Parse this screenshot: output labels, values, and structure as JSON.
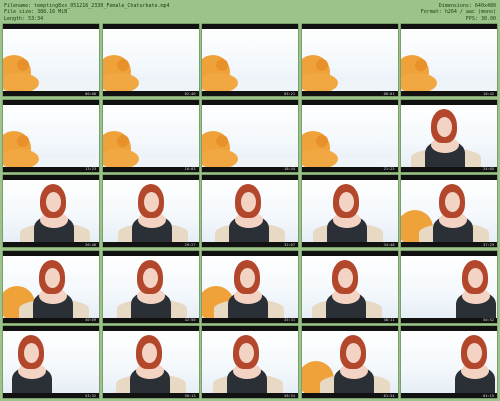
{
  "header": {
    "filename_line": "Filename: tempting8xx_051216_2330_Female_Chaturbate.mp4",
    "filesize_line": "File size: 388.16 MiB",
    "length_line": "Length: 53:34",
    "dimensions_line": "Dimensions: 640x480",
    "format_line": "Format: h264 / aac (mono)",
    "fps_line": "FPS: 30.00"
  },
  "thumbnails": [
    {
      "ts": "00:00",
      "scene": "bear"
    },
    {
      "ts": "02:40",
      "scene": "bear"
    },
    {
      "ts": "05:21",
      "scene": "bear"
    },
    {
      "ts": "08:01",
      "scene": "bear"
    },
    {
      "ts": "10:42",
      "scene": "bear"
    },
    {
      "ts": "13:23",
      "scene": "bear"
    },
    {
      "ts": "16:03",
      "scene": "bear"
    },
    {
      "ts": "18:44",
      "scene": "bear"
    },
    {
      "ts": "21:25",
      "scene": "bear"
    },
    {
      "ts": "24:05",
      "scene": "woman-blanket"
    },
    {
      "ts": "26:46",
      "scene": "woman-center"
    },
    {
      "ts": "29:27",
      "scene": "woman-center"
    },
    {
      "ts": "32:07",
      "scene": "woman-center"
    },
    {
      "ts": "34:48",
      "scene": "woman-center"
    },
    {
      "ts": "37:29",
      "scene": "woman-bear"
    },
    {
      "ts": "40:09",
      "scene": "woman-bear"
    },
    {
      "ts": "42:50",
      "scene": "woman-blanket"
    },
    {
      "ts": "45:31",
      "scene": "woman-bear"
    },
    {
      "ts": "48:11",
      "scene": "woman-center"
    },
    {
      "ts": "50:52",
      "scene": "woman-right"
    },
    {
      "ts": "53:32",
      "scene": "woman-left"
    },
    {
      "ts": "56:13",
      "scene": "woman-center"
    },
    {
      "ts": "58:54",
      "scene": "woman-center"
    },
    {
      "ts": "61:34",
      "scene": "woman-bear"
    },
    {
      "ts": "64:15",
      "scene": "woman-right"
    }
  ]
}
